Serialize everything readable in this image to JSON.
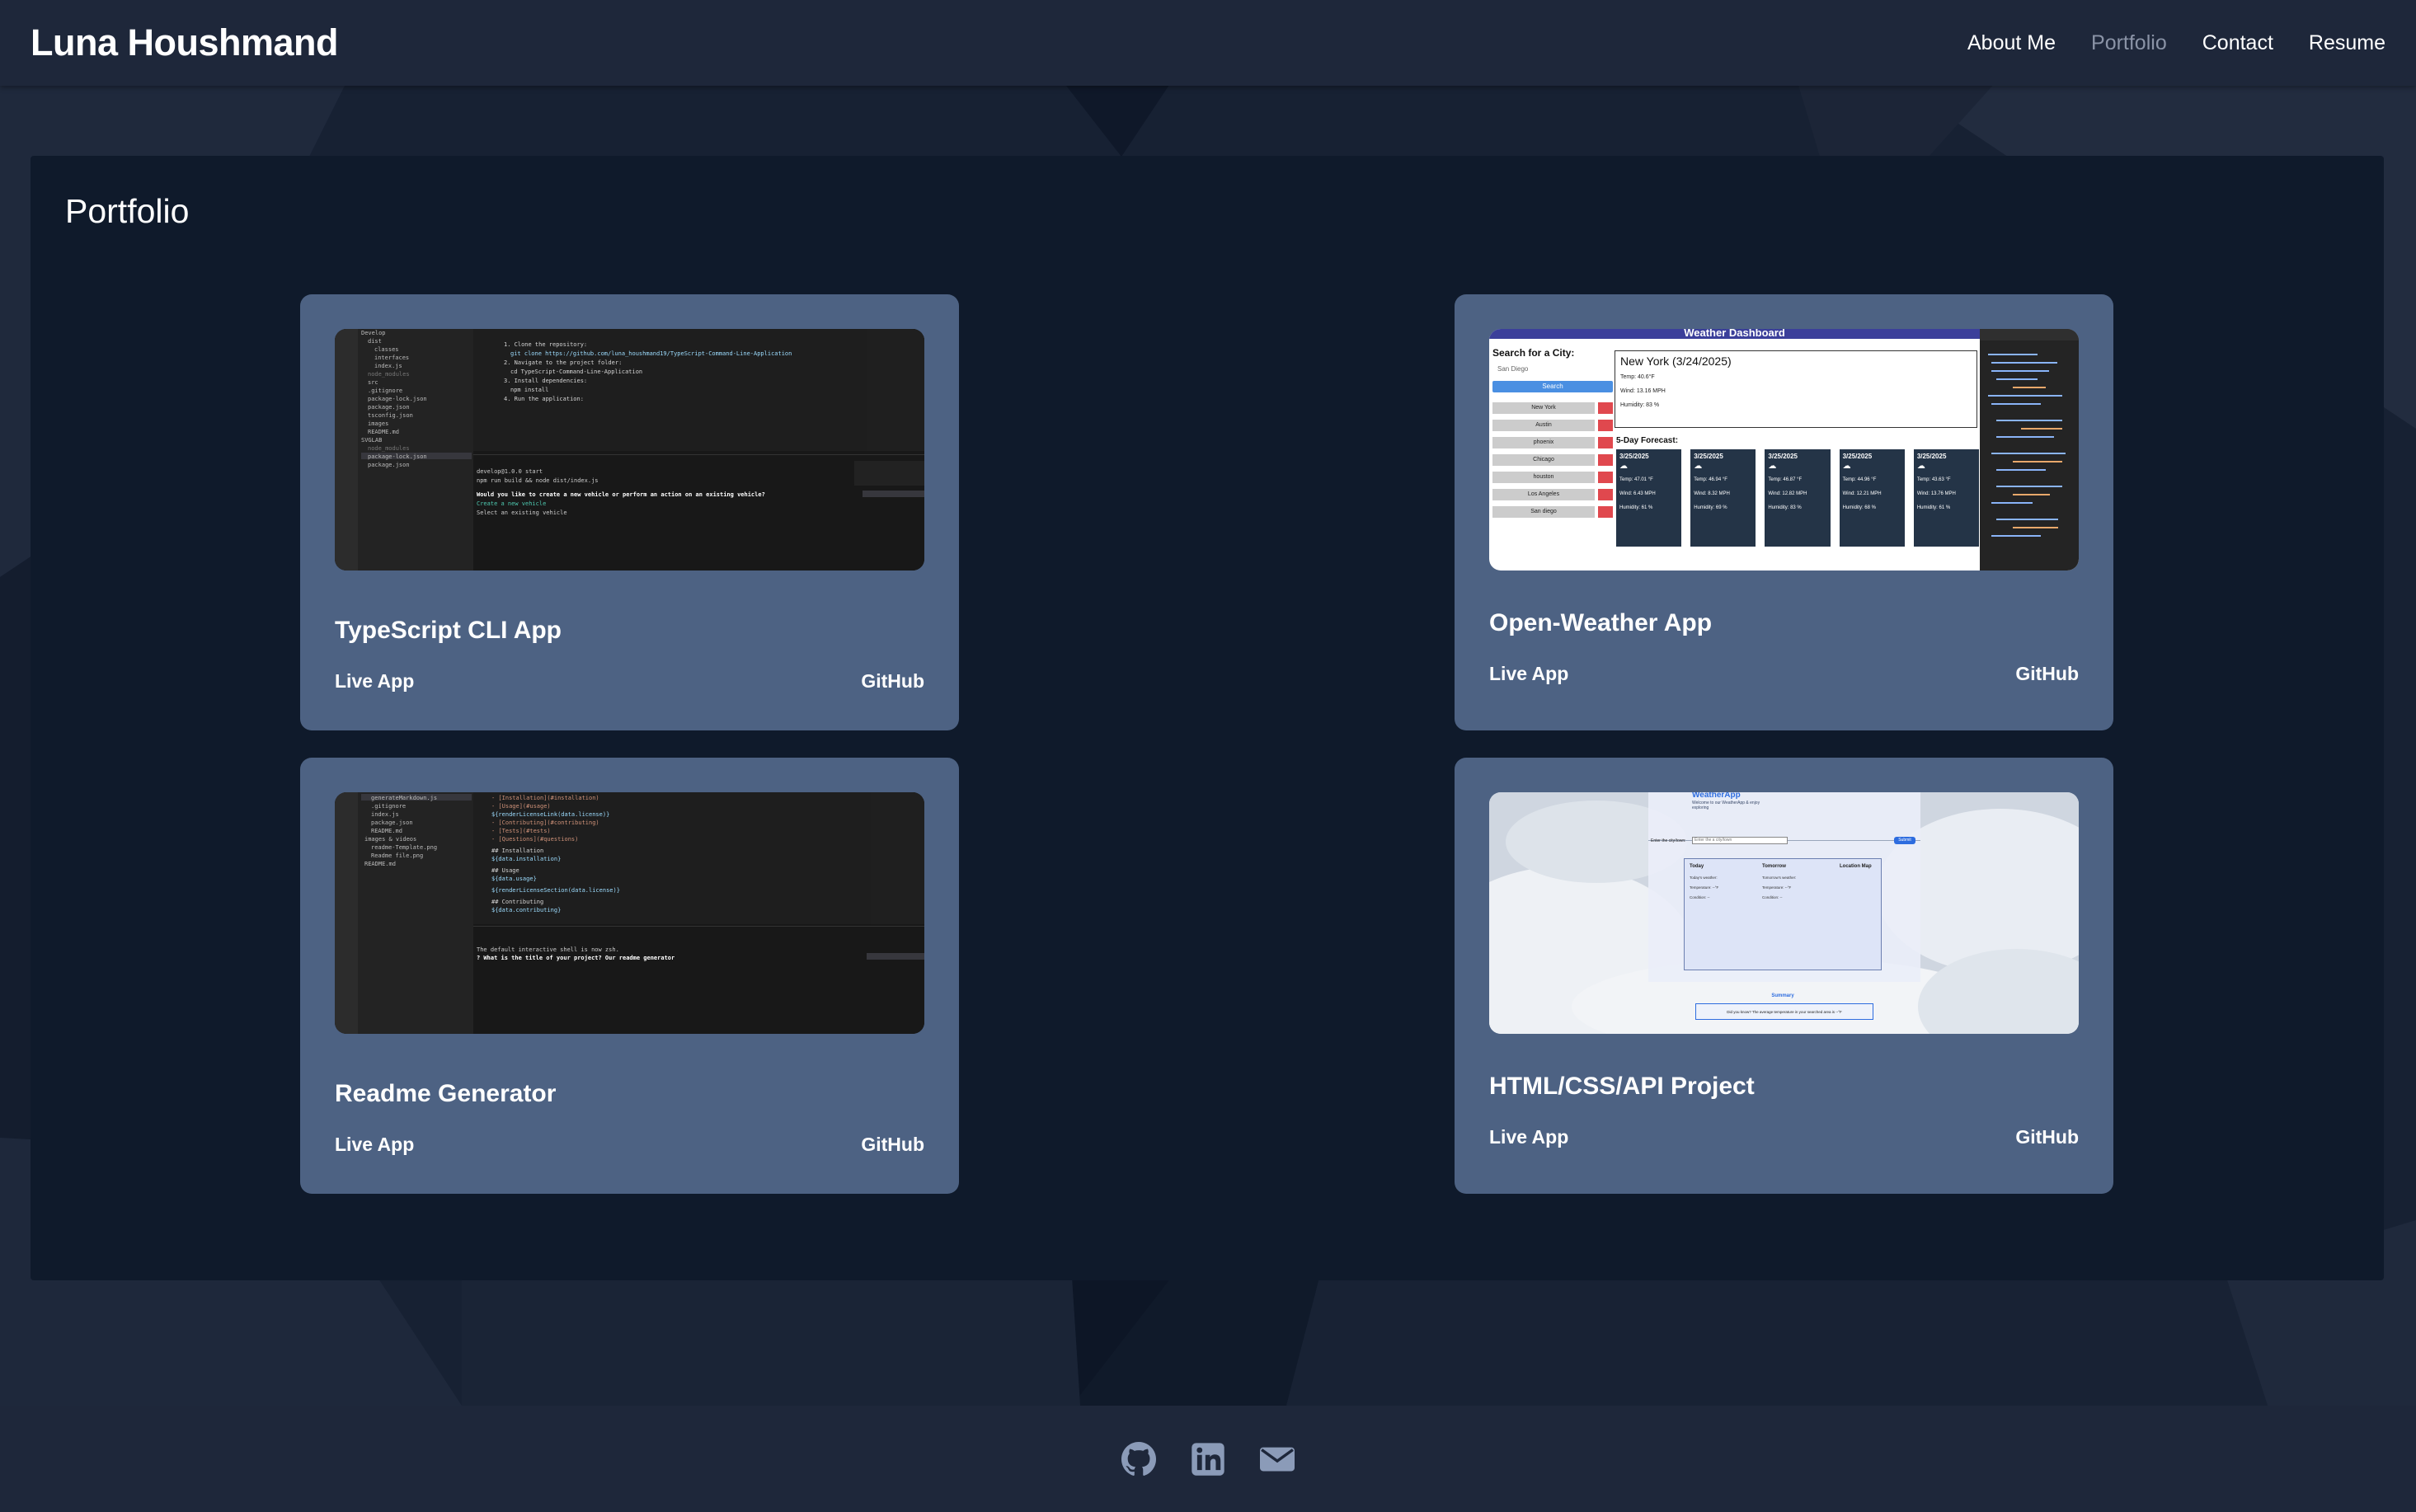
{
  "header": {
    "brand": "Luna Houshmand",
    "nav": [
      {
        "label": "About Me",
        "active": false
      },
      {
        "label": "Portfolio",
        "active": true
      },
      {
        "label": "Contact",
        "active": false
      },
      {
        "label": "Resume",
        "active": false
      }
    ]
  },
  "main": {
    "title": "Portfolio",
    "projects": [
      {
        "title": "TypeScript CLI App",
        "live_label": "Live App",
        "github_label": "GitHub",
        "thumb": {
          "terminal_lines": [
            "1. Clone the repository:",
            "git clone https://github.com/luna_houshmand19/TypeScript-Command-Line-Application",
            "2. Navigate to the project folder:",
            "cd TypeScript-Command-Line-Application",
            "3. Install dependencies:",
            "npm install",
            "4. Run the application:",
            "develop@1.0.0 start",
            "npm run build && node dist/index.js",
            "Would you like to create a new vehicle or perform an action on an existing vehicle?",
            "Create a new vehicle",
            "Select an existing vehicle"
          ],
          "files": [
            "Develop",
            "dist",
            "classes",
            "interfaces",
            "index.js",
            "node_modules",
            "src",
            ".gitignore",
            "package-lock.json",
            "package.json",
            "tsconfig.json",
            "images",
            "README.md",
            "SVGLAB",
            "node_modules",
            "package-lock.json",
            "package.json"
          ]
        }
      },
      {
        "title": "Open-Weather App",
        "live_label": "Live App",
        "github_label": "GitHub",
        "thumb": {
          "heading": "Weather Dashboard",
          "search_label": "Search for a City:",
          "search_value": "San Diego",
          "search_button": "Search",
          "cities": [
            "New York",
            "Austin",
            "phoenix",
            "Chicago",
            "houston",
            "Los Angeles",
            "San diego"
          ],
          "current_title": "New York (3/24/2025)",
          "current_temp": "Temp: 40.6°F",
          "current_wind": "Wind: 13.16 MPH",
          "current_humidity": "Humidity: 83 %",
          "forecast_label": "5-Day Forecast:",
          "forecast": [
            {
              "date": "3/25/2025",
              "temp": "Temp: 47.01 °F",
              "wind": "Wind: 6.43 MPH",
              "humidity": "Humidity: 61 %"
            },
            {
              "date": "3/25/2025",
              "temp": "Temp: 46.94 °F",
              "wind": "Wind: 8.32 MPH",
              "humidity": "Humidity: 69 %"
            },
            {
              "date": "3/25/2025",
              "temp": "Temp: 46.87 °F",
              "wind": "Wind: 12.82 MPH",
              "humidity": "Humidity: 83 %"
            },
            {
              "date": "3/25/2025",
              "temp": "Temp: 44.96 °F",
              "wind": "Wind: 12.21 MPH",
              "humidity": "Humidity: 68 %"
            },
            {
              "date": "3/25/2025",
              "temp": "Temp: 43.63 °F",
              "wind": "Wind: 13.76 MPH",
              "humidity": "Humidity: 61 %"
            }
          ]
        }
      },
      {
        "title": "Readme Generator",
        "live_label": "Live App",
        "github_label": "GitHub",
        "thumb": {
          "terminal_lines": [
            "- [Installation](#installation)",
            "- [Usage](#usage)",
            "${renderLicenseLink(data.license)}",
            "- [Contributing](#contributing)",
            "- [Tests](#tests)",
            "- [Questions](#questions)",
            "## Installation",
            "${data.installation}",
            "## Usage",
            "${data.usage}",
            "${renderLicenseSection(data.license)}",
            "## Contributing",
            "${data.contributing}",
            "The default interactive shell is now zsh.",
            "? What is the title of your project? Our readme generator"
          ],
          "files": [
            "generateMarkdown.js",
            ".gitignore",
            "index.js",
            "package.json",
            "README.md",
            "images & videos",
            "readme-Template.png",
            "Readme file.png",
            "README.md"
          ]
        }
      },
      {
        "title": "HTML/CSS/API Project",
        "live_label": "Live App",
        "github_label": "GitHub",
        "thumb": {
          "app_title": "WeatherApp",
          "tagline": "Welcome to our WeatherApp & enjoy exploring",
          "input_label": "Enter the city/town:",
          "input_placeholder": "Enter the a city/town",
          "button": "Submit",
          "col_today": "Today",
          "col_tomorrow": "Tomorrow",
          "col_map": "Location Map",
          "today_weather": "Today's weather:",
          "tomorrow_weather": "Tomorrow's weather:",
          "temp_label": "Temperature: --°F",
          "cond_label": "Condition: --",
          "summary_title": "Summary",
          "summary_text": "Did you know? The average temperature in your searched area is --°F"
        }
      }
    ]
  },
  "footer": {
    "icons": [
      "github-icon",
      "linkedin-icon",
      "email-icon"
    ]
  },
  "colors": {
    "background": "#182234",
    "header": "#1e273a",
    "panel": "#0f1a2b",
    "card": "#4d6283",
    "nav_active": "#8a93a6",
    "footer_icon": "#8b9bb8"
  }
}
